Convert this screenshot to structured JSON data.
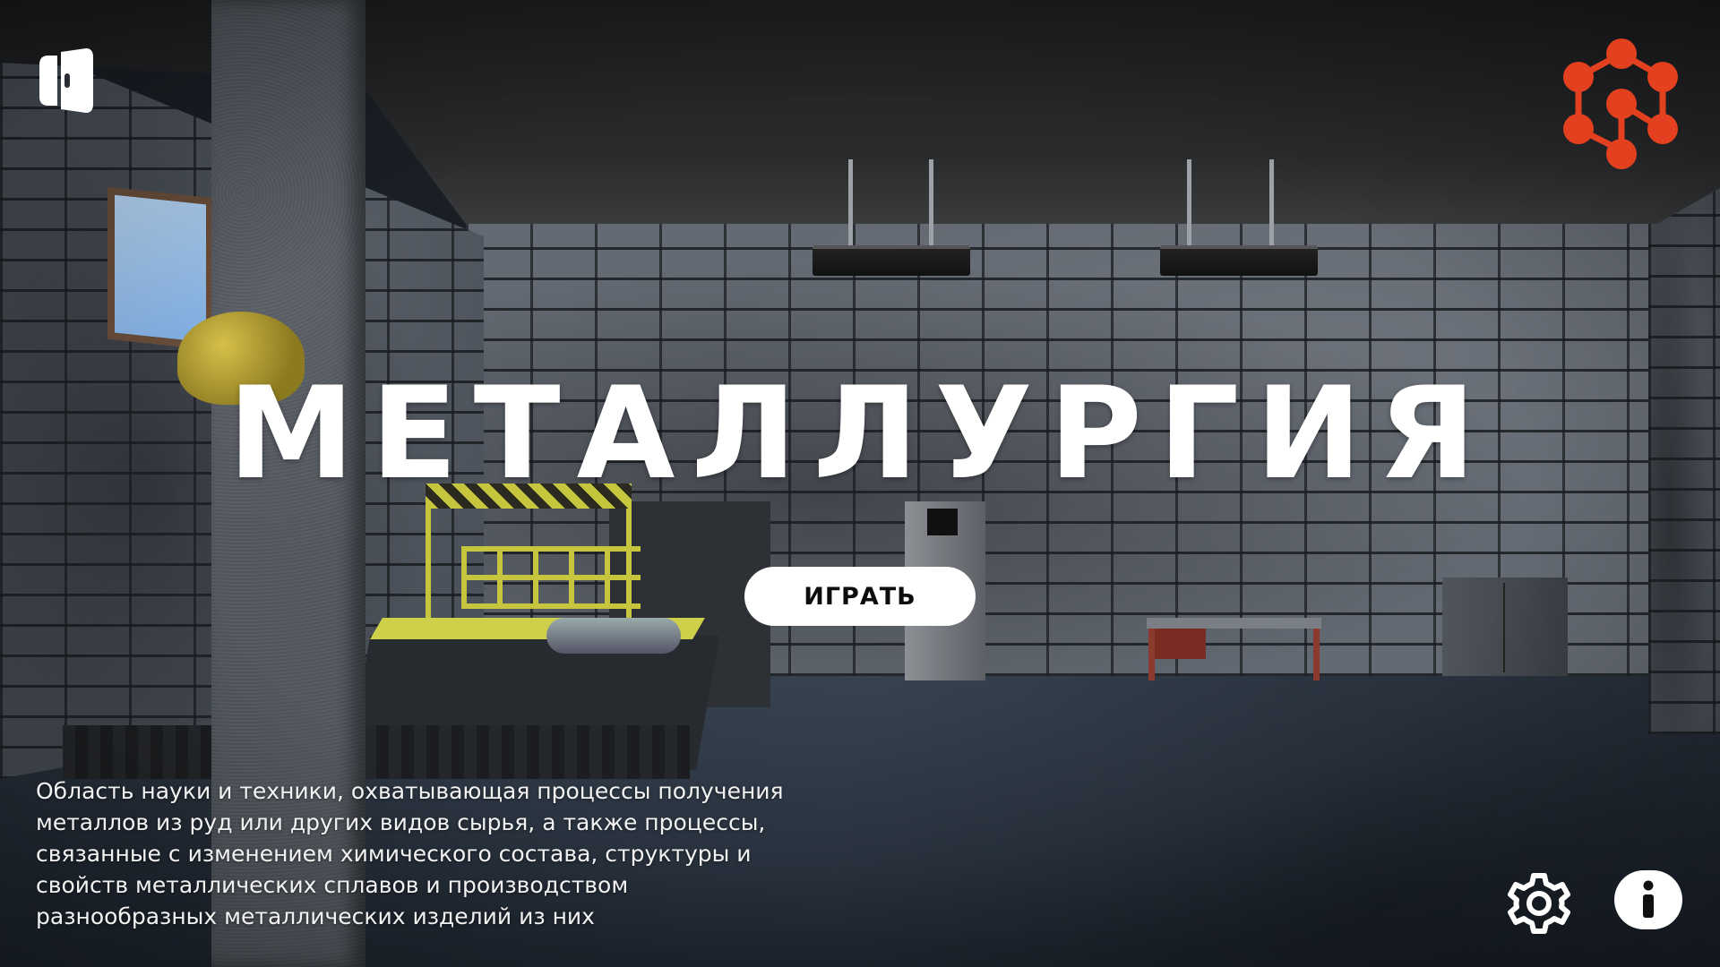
{
  "game": {
    "title": "МЕТАЛЛУРГИЯ",
    "play_label": "ИГРАТЬ",
    "description": "Область науки и техники, охватывающая процессы получения металлов из руд или других видов сырья, а также процессы, связанные с изменением химического состава, структуры и свойств металлических сплавов и производством разнообразных металлических изделий из них"
  },
  "icons": {
    "top_left": "app-logo-icon",
    "top_right": "molecule-logo-icon",
    "bottom_settings": "gear-icon",
    "bottom_info": "info-icon"
  },
  "colors": {
    "accent_logo": "#e2401e",
    "title_text": "#ffffff",
    "button_bg": "#ffffff",
    "button_text": "#0d0d0d"
  }
}
